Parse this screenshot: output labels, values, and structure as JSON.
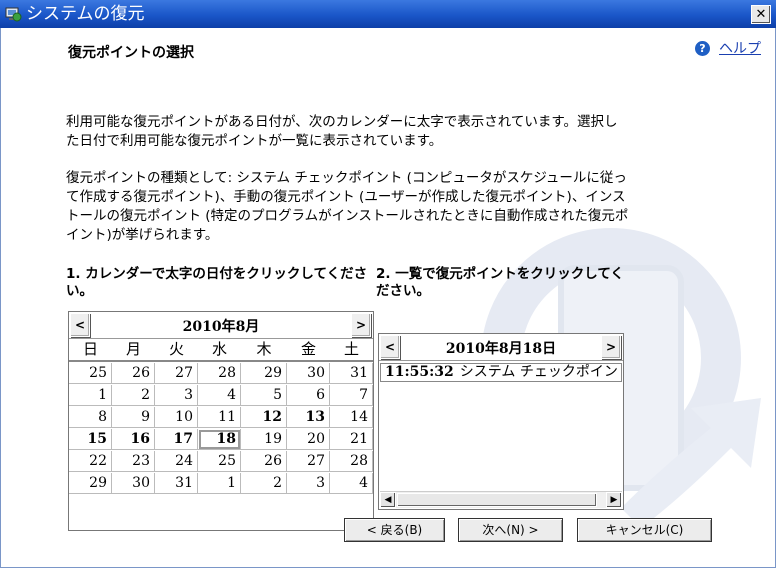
{
  "window": {
    "title": "システムの復元",
    "close_glyph": "✕"
  },
  "page_title": "復元ポイントの選択",
  "help": {
    "icon_glyph": "?",
    "label": "ヘルプ"
  },
  "desc1": "利用可能な復元ポイントがある日付が、次のカレンダーに太字で表示されています。選択した日付で利用可能な復元ポイントが一覧に表示されています。",
  "desc2": "復元ポイントの種類として: システム チェックポイント (コンピュータがスケジュールに従って作成する復元ポイント)、手動の復元ポイント (ユーザーが作成した復元ポイント)、インストールの復元ポイント (特定のプログラムがインストールされたときに自動作成された復元ポイント)が挙げられます。",
  "step1": "1. カレンダーで太字の日付をクリックしてください。",
  "step2": "2. 一覧で復元ポイントをクリックしてください。",
  "calendar": {
    "month": "2010年8月",
    "prev": "<",
    "next": ">",
    "weekdays": [
      "日",
      "月",
      "火",
      "水",
      "木",
      "金",
      "土"
    ],
    "weeks": [
      [
        "25",
        "26",
        "27",
        "28",
        "29",
        "30",
        "31"
      ],
      [
        "1",
        "2",
        "3",
        "4",
        "5",
        "6",
        "7"
      ],
      [
        "8",
        "9",
        "10",
        "11",
        "12",
        "13",
        "14"
      ],
      [
        "15",
        "16",
        "17",
        "18",
        "19",
        "20",
        "21"
      ],
      [
        "22",
        "23",
        "24",
        "25",
        "26",
        "27",
        "28"
      ],
      [
        "29",
        "30",
        "31",
        "1",
        "2",
        "3",
        "4"
      ]
    ],
    "bold_dates": [
      "12",
      "13",
      "15",
      "16",
      "17",
      "18"
    ],
    "selected": "18"
  },
  "list": {
    "date": "2010年8月18日",
    "prev": "<",
    "next": ">",
    "items": [
      {
        "time": "11:55:32",
        "desc": "システム チェックポイント"
      }
    ],
    "scroll_left": "◀",
    "scroll_right": "▶"
  },
  "buttons": {
    "back": "< 戻る(B)",
    "next": "次へ(N) >",
    "cancel": "キャンセル(C)"
  },
  "colors": {
    "titlebar": "#1a56c8",
    "link": "#1a3fb0"
  }
}
